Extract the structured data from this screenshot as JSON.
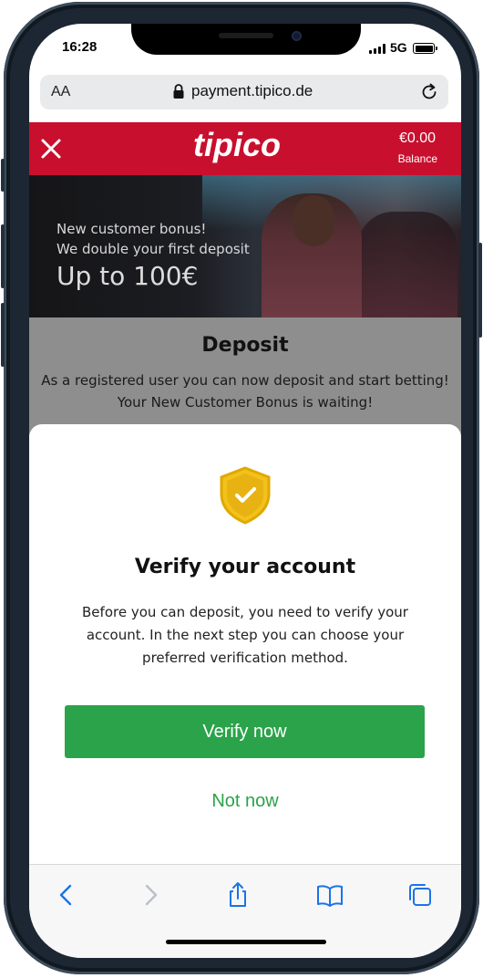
{
  "status_bar": {
    "time": "16:28",
    "network": "5G"
  },
  "browser": {
    "text_size_label": "AA",
    "url": "payment.tipico.de"
  },
  "header": {
    "logo": "tipico",
    "balance_amount": "€0.00",
    "balance_label": "Balance",
    "brand_color": "#c8102e"
  },
  "banner": {
    "line1": "New customer bonus!",
    "line2": "We double your first deposit",
    "headline": "Up to 100€"
  },
  "deposit": {
    "title": "Deposit",
    "line1": "As a registered user you can now deposit and start betting!",
    "line2": "Your New Customer Bonus is waiting!"
  },
  "modal": {
    "icon": "shield-check-icon",
    "title": "Verify your account",
    "body": "Before you can deposit, you need to verify your account. In the next step you can choose your preferred verification method.",
    "primary_button": "Verify now",
    "secondary_button": "Not now",
    "accent_color": "#2aa34a"
  },
  "toolbar": {
    "icons": [
      "back-icon",
      "forward-icon",
      "share-icon",
      "bookmarks-icon",
      "tabs-icon"
    ]
  }
}
